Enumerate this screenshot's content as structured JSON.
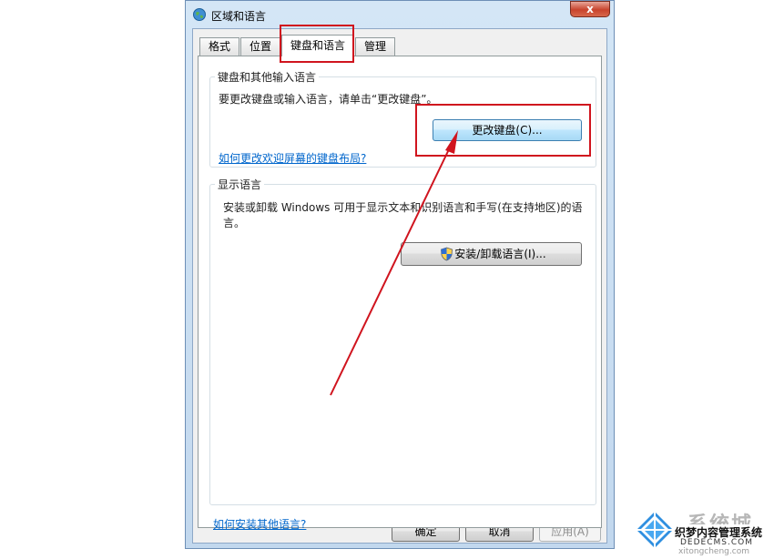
{
  "window": {
    "title": "区域和语言",
    "close_label": "x"
  },
  "tabs": [
    {
      "label": "格式"
    },
    {
      "label": "位置"
    },
    {
      "label": "键盘和语言"
    },
    {
      "label": "管理"
    }
  ],
  "keyboard_group": {
    "title": "键盘和其他输入语言",
    "description": "要更改键盘或输入语言，请单击“更改键盘”。",
    "change_keyboard_button": "更改键盘(C)...",
    "welcome_link": "如何更改欢迎屏幕的键盘布局?"
  },
  "display_group": {
    "title": "显示语言",
    "description_line1": "安装或卸载 Windows 可用于显示文本和识别语言和手写(在支持地区)的语",
    "description_line2": "言。",
    "install_button": "安装/卸载语言(I)..."
  },
  "bottom_link": "如何安装其他语言?",
  "footer": {
    "ok": "确定",
    "cancel": "取消",
    "apply": "应用(A)"
  },
  "annotation": {
    "color": "#d0141e"
  },
  "watermark": {
    "brand": "系统城",
    "line1": "织梦内容管理系统",
    "line2": "DEDECMS.COM",
    "url": "xitongcheng.com"
  }
}
